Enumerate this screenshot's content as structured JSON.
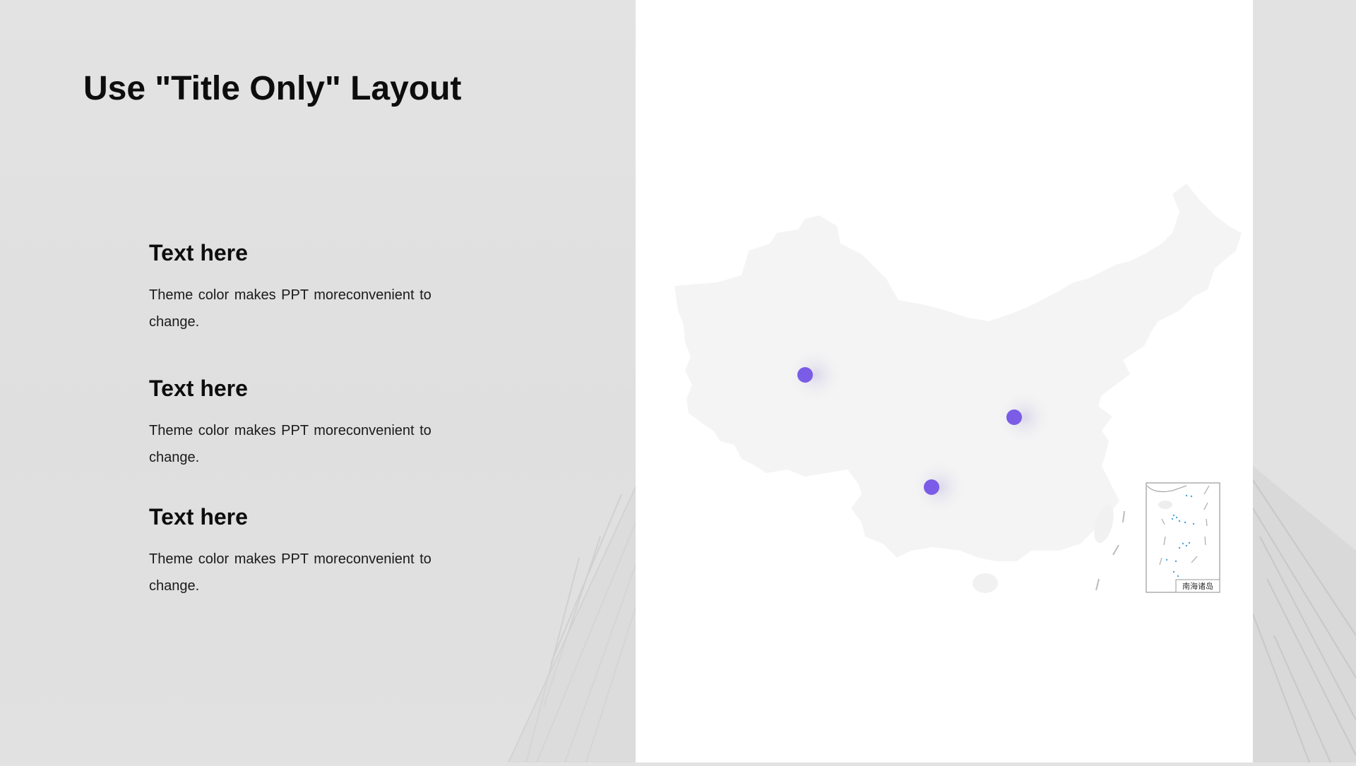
{
  "slide": {
    "title": "Use \"Title Only\" Layout"
  },
  "blocks": [
    {
      "heading": "Text here",
      "body": "Theme color makes PPT moreconvenient to change."
    },
    {
      "heading": "Text here",
      "body": "Theme color makes PPT moreconvenient to change."
    },
    {
      "heading": "Text here",
      "body": "Theme color makes PPT moreconvenient to change."
    }
  ],
  "map": {
    "inset_label": "南海诸岛",
    "marker_color": "#7b5ce6",
    "land_color": "#f4f4f4",
    "markers": [
      {
        "name": "west-marker"
      },
      {
        "name": "east-marker"
      },
      {
        "name": "south-marker"
      }
    ]
  }
}
